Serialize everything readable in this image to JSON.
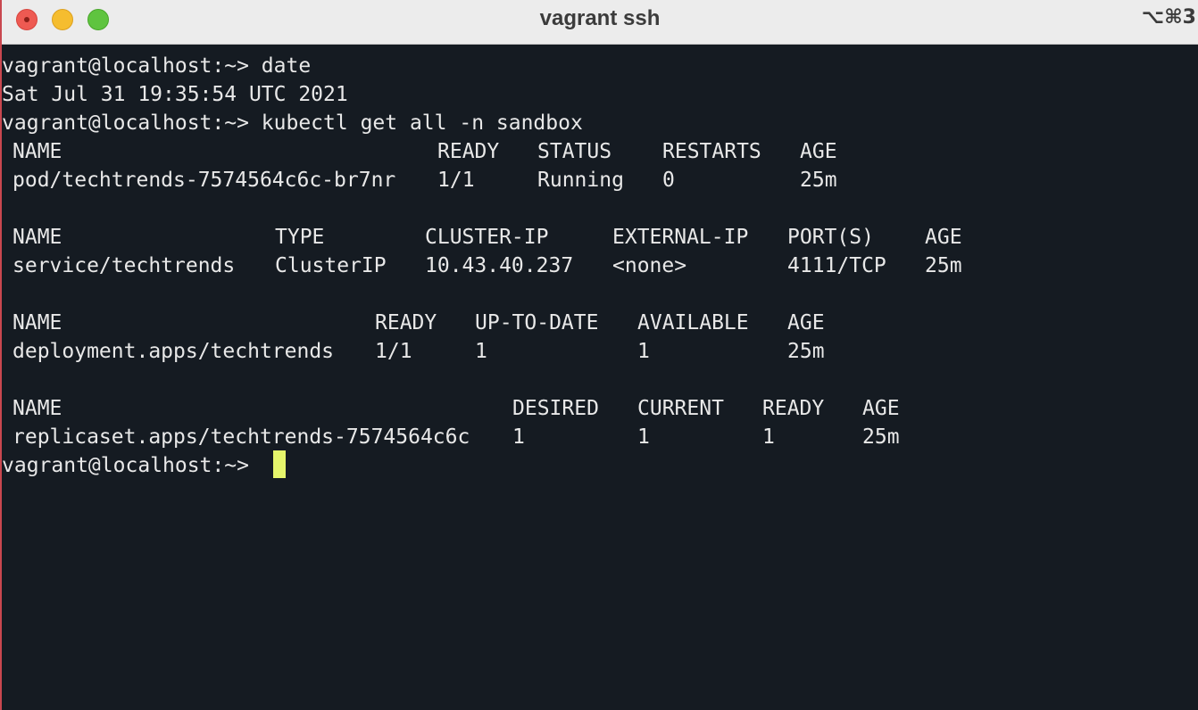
{
  "window": {
    "title": "vagrant ssh",
    "shortcut": "⌥⌘3"
  },
  "terminal": {
    "prompt": "vagrant@localhost:~>",
    "lines": {
      "cmd1": "vagrant@localhost:~> date",
      "date_output": "Sat Jul 31 19:35:54 UTC 2021",
      "cmd2": "vagrant@localhost:~> kubectl get all -n sandbox",
      "final_prompt": "vagrant@localhost:~> "
    },
    "pods": {
      "headers": [
        "NAME",
        "READY",
        "STATUS",
        "RESTARTS",
        "AGE"
      ],
      "rows": [
        [
          "pod/techtrends-7574564c6c-br7nr",
          "1/1",
          "Running",
          "0",
          "25m"
        ]
      ]
    },
    "services": {
      "headers": [
        "NAME",
        "TYPE",
        "CLUSTER-IP",
        "EXTERNAL-IP",
        "PORT(S)",
        "AGE"
      ],
      "rows": [
        [
          "service/techtrends",
          "ClusterIP",
          "10.43.40.237",
          "<none>",
          "4111/TCP",
          "25m"
        ]
      ]
    },
    "deployments": {
      "headers": [
        "NAME",
        "READY",
        "UP-TO-DATE",
        "AVAILABLE",
        "AGE"
      ],
      "rows": [
        [
          "deployment.apps/techtrends",
          "1/1",
          "1",
          "1",
          "25m"
        ]
      ]
    },
    "replicasets": {
      "headers": [
        "NAME",
        "DESIRED",
        "CURRENT",
        "READY",
        "AGE"
      ],
      "rows": [
        [
          "replicaset.apps/techtrends-7574564c6c",
          "1",
          "1",
          "1",
          "25m"
        ]
      ]
    }
  },
  "colors": {
    "terminal_background": "#151b22",
    "terminal_text": "#e8e8e8",
    "cursor": "#e5f56b",
    "titlebar": "#ececec"
  }
}
